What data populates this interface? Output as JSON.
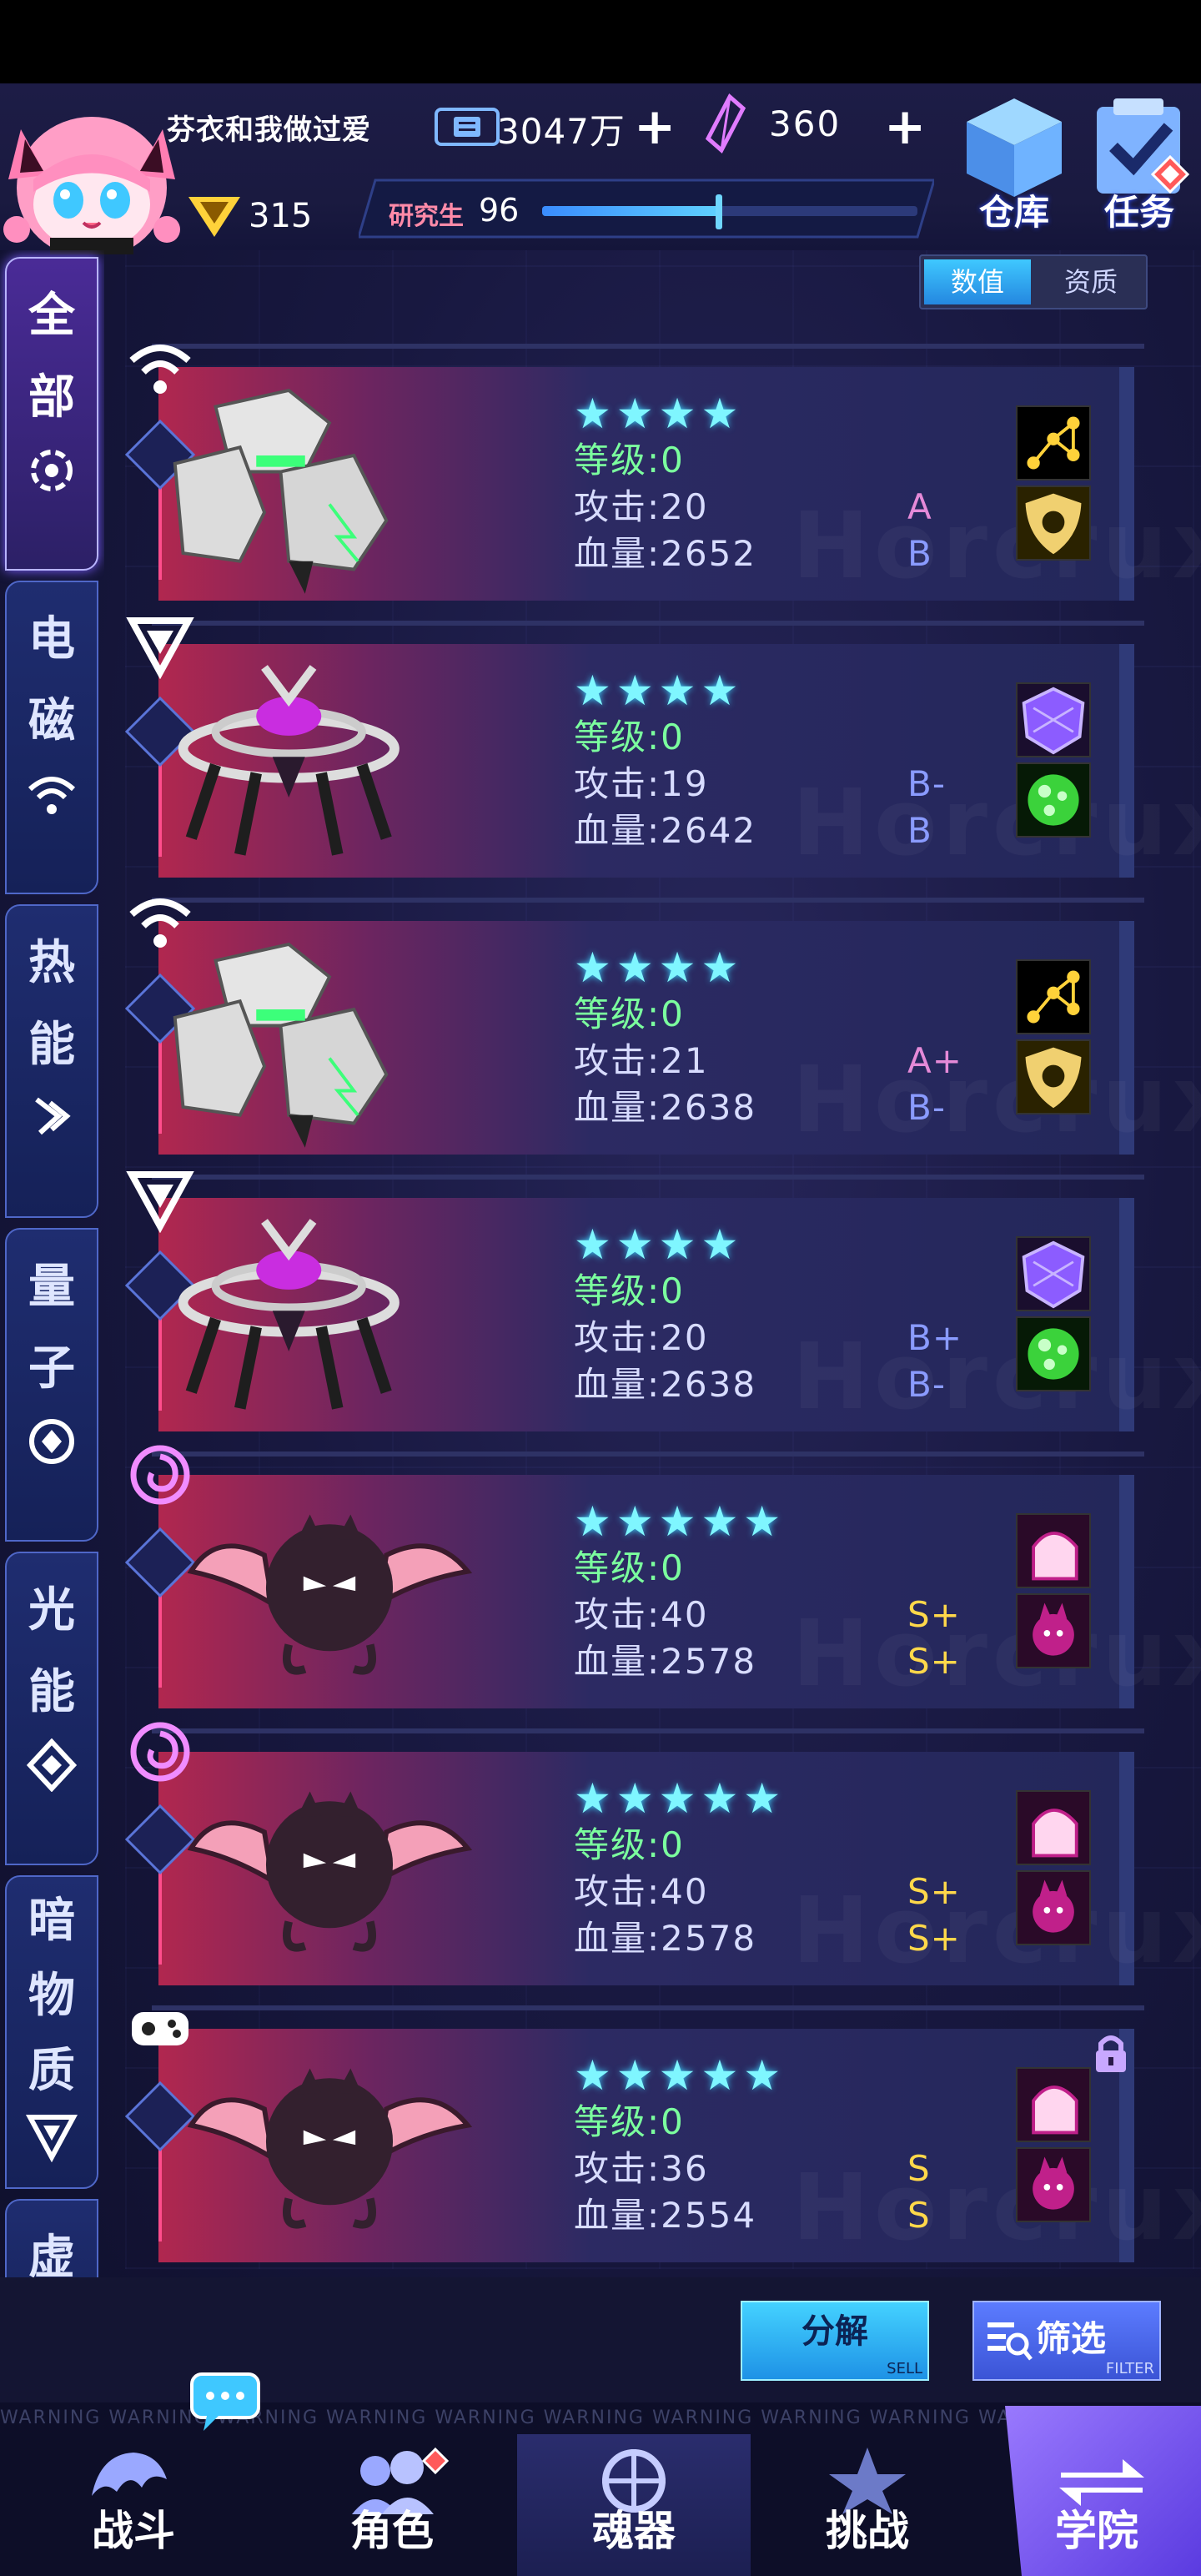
{
  "player": {
    "nickname": "芬衣和我做过爱",
    "money": "3047万",
    "crystals": "360",
    "rank_value": "315",
    "xp_label": "研究生",
    "xp_level": "96",
    "xp_progress": 0.47
  },
  "top_buttons": {
    "warehouse": "仓库",
    "tasks": "任务"
  },
  "view_tabs": {
    "values": "数值",
    "quality": "资质",
    "active": "数值"
  },
  "sidebar": {
    "items": [
      {
        "label": "全部",
        "chars": [
          "全",
          "部"
        ],
        "icon": "all-icon",
        "active": true
      },
      {
        "label": "电磁",
        "chars": [
          "电",
          "磁"
        ],
        "icon": "wifi-icon",
        "active": false
      },
      {
        "label": "热能",
        "chars": [
          "热",
          "能"
        ],
        "icon": "heat-icon",
        "active": false
      },
      {
        "label": "量子",
        "chars": [
          "量",
          "子"
        ],
        "icon": "quantum-icon",
        "active": false
      },
      {
        "label": "光能",
        "chars": [
          "光",
          "能"
        ],
        "icon": "diamond-icon",
        "active": false
      },
      {
        "label": "暗物质",
        "chars": [
          "暗",
          "物",
          "质"
        ],
        "icon": "triangle-icon",
        "active": false
      },
      {
        "label": "虚",
        "chars": [
          "虚"
        ],
        "icon": "",
        "active": false
      }
    ]
  },
  "cards": [
    {
      "type_icon": "wifi-icon",
      "creature": "rock-golem",
      "stars": "★★★★",
      "level": "等级:0",
      "attack": "攻击:20",
      "hp": "血量:2652",
      "atk_grade": "A",
      "hp_grade": "B",
      "atk_grade_color": "#e58ad8",
      "hp_grade_color": "#8a9bff",
      "skills": [
        "constellation-icon",
        "shield-icon"
      ],
      "locked": false
    },
    {
      "type_icon": "triangle-icon",
      "creature": "ring-spider",
      "stars": "★★★★",
      "level": "等级:0",
      "attack": "攻击:19",
      "hp": "血量:2642",
      "atk_grade": "B-",
      "hp_grade": "B",
      "atk_grade_color": "#8a9bff",
      "hp_grade_color": "#8a9bff",
      "skills": [
        "hex-shield-icon",
        "green-orb-icon"
      ],
      "locked": false
    },
    {
      "type_icon": "wifi-icon",
      "creature": "rock-golem",
      "stars": "★★★★",
      "level": "等级:0",
      "attack": "攻击:21",
      "hp": "血量:2638",
      "atk_grade": "A+",
      "hp_grade": "B-",
      "atk_grade_color": "#e58ad8",
      "hp_grade_color": "#8a9bff",
      "skills": [
        "constellation-icon",
        "shield-icon"
      ],
      "locked": false
    },
    {
      "type_icon": "triangle-icon",
      "creature": "ring-spider",
      "stars": "★★★★",
      "level": "等级:0",
      "attack": "攻击:20",
      "hp": "血量:2638",
      "atk_grade": "B+",
      "hp_grade": "B-",
      "atk_grade_color": "#8a9bff",
      "hp_grade_color": "#8a9bff",
      "skills": [
        "hex-shield-icon",
        "green-orb-icon"
      ],
      "locked": false
    },
    {
      "type_icon": "spiral-icon",
      "creature": "bat-demon",
      "stars": "★★★★★",
      "level": "等级:0",
      "attack": "攻击:40",
      "hp": "血量:2578",
      "atk_grade": "S+",
      "hp_grade": "S+",
      "atk_grade_color": "#ffd84a",
      "hp_grade_color": "#ffd84a",
      "skills": [
        "ghost-icon",
        "imp-icon"
      ],
      "locked": false
    },
    {
      "type_icon": "spiral-icon",
      "creature": "bat-demon",
      "stars": "★★★★★",
      "level": "等级:0",
      "attack": "攻击:40",
      "hp": "血量:2578",
      "atk_grade": "S+",
      "hp_grade": "S+",
      "atk_grade_color": "#ffd84a",
      "hp_grade_color": "#ffd84a",
      "skills": [
        "ghost-icon",
        "imp-icon"
      ],
      "locked": false
    },
    {
      "type_icon": "gamepad-icon",
      "creature": "bat-demon",
      "stars": "★★★★★",
      "level": "等级:0",
      "attack": "攻击:36",
      "hp": "血量:2554",
      "atk_grade": "S",
      "hp_grade": "S",
      "atk_grade_color": "#ffd84a",
      "hp_grade_color": "#ffd84a",
      "skills": [
        "ghost-icon",
        "imp-icon"
      ],
      "locked": true
    }
  ],
  "actions": {
    "sell": "分解",
    "sell_sub": "SELL",
    "filter": "筛选",
    "filter_sub": "FILTER"
  },
  "nav": {
    "warning_text": "WARNING WARNING WARNING WARNING WARNING WARNING WARNING WARNING WARNING WARNING WARNING WARNING",
    "items": [
      {
        "label": "战斗",
        "icon": "battle-icon"
      },
      {
        "label": "角色",
        "icon": "character-icon"
      },
      {
        "label": "魂器",
        "icon": "soul-vessel-icon"
      },
      {
        "label": "挑战",
        "icon": "challenge-icon"
      },
      {
        "label": "学院",
        "icon": "academy-icon"
      }
    ],
    "active": "魂器"
  },
  "watermark": "Horcrux",
  "colors": {
    "accent_cyan": "#3fc8ff",
    "card_pink": "#b1274f",
    "star": "#7ff6ff",
    "level_green": "#7bff9e",
    "academy": "#8b6bff"
  }
}
